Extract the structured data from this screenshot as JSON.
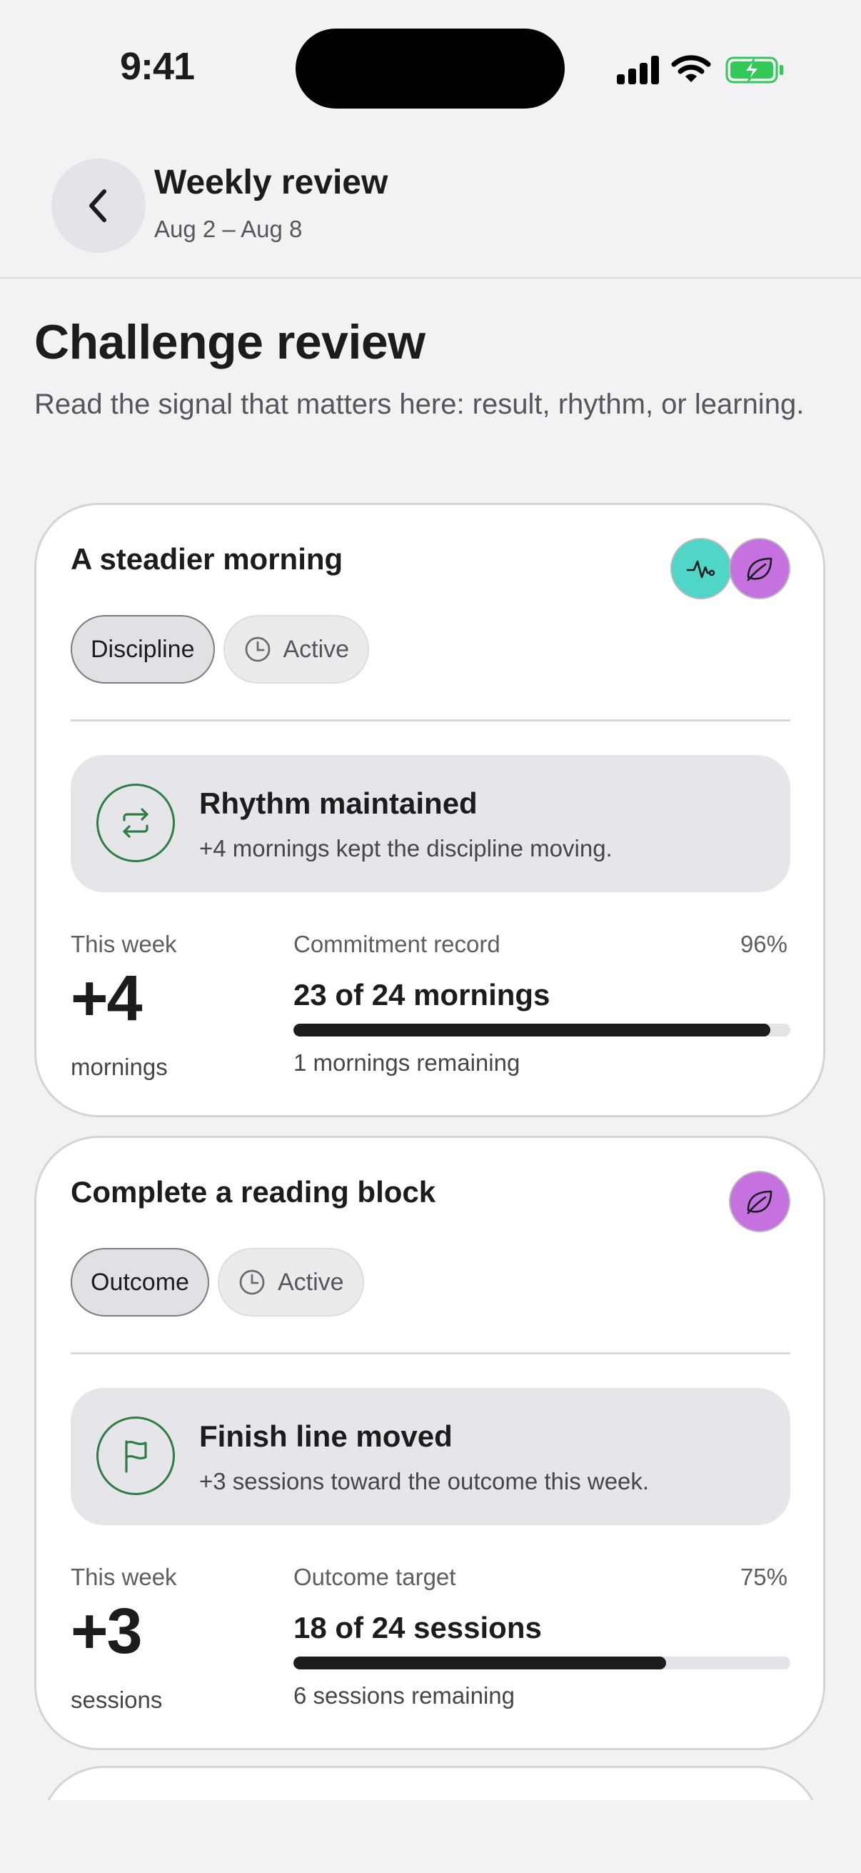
{
  "status_bar": {
    "time": "9:41",
    "icons": [
      "signal-icon",
      "wifi-icon",
      "battery-charging-icon"
    ]
  },
  "header": {
    "back_icon": "chevron-left-icon",
    "title": "Weekly review",
    "subtitle": "Aug 2 – Aug 8"
  },
  "page": {
    "title": "Challenge review",
    "description": "Read the signal that matters here: result, rhythm, or learning."
  },
  "colors": {
    "accent_green": "#2e7d43",
    "badge_teal": "#4fd6c6",
    "badge_purple": "#c572e0",
    "progress": "#1c1c1e"
  },
  "challenges": [
    {
      "title": "A steadier morning",
      "badges": [
        "pulse-icon",
        "leaf-icon"
      ],
      "type_label": "Discipline",
      "status_label": "Active",
      "callout": {
        "icon": "repeat-icon",
        "title": "Rhythm maintained",
        "text": "+4 mornings kept the discipline moving."
      },
      "week_label": "This week",
      "week_value": "+4",
      "week_unit": "mornings",
      "record_label": "Commitment record",
      "record_pct": "96%",
      "progress": 0.96,
      "record_value": "23 of 24 mornings",
      "remaining": "1 mornings remaining"
    },
    {
      "title": "Complete a reading block",
      "badges": [
        "leaf-icon"
      ],
      "type_label": "Outcome",
      "status_label": "Active",
      "callout": {
        "icon": "flag-icon",
        "title": "Finish line moved",
        "text": "+3 sessions toward the outcome this week."
      },
      "week_label": "This week",
      "week_value": "+3",
      "week_unit": "sessions",
      "record_label": "Outcome target",
      "record_pct": "75%",
      "progress": 0.75,
      "record_value": "18 of 24 sessions",
      "remaining": "6 sessions remaining"
    }
  ]
}
